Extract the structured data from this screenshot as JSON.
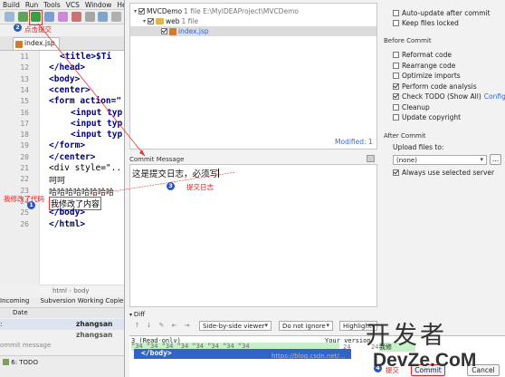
{
  "ide": {
    "menu": [
      "Build",
      "Run",
      "Tools",
      "VCS",
      "Window",
      "He"
    ],
    "file_tab": "index.jsp",
    "line_numbers": [
      "11",
      "12",
      "13",
      "14",
      "15",
      "16",
      "17",
      "18",
      "19",
      "20",
      "21",
      "22",
      "23",
      "24",
      "25",
      "26"
    ],
    "code_lines": [
      "<title>$Ti",
      "</head>",
      "<body>",
      "<center>",
      "<form action=\"",
      "<input typ",
      "<input typ",
      "<input typ",
      "</form>",
      "</center>",
      "<div style=\"..",
      "呵呵",
      "哈哈哈哈哈哈哈哈",
      "我修改了内容",
      "</body>",
      "</html>"
    ],
    "breadcrumb": [
      "html",
      "body"
    ],
    "bottom_tabs": [
      "Incoming",
      "Subversion Working Copies"
    ],
    "history_header": "Date",
    "history_rows": [
      {
        "author": "zhangsan"
      },
      {
        "author": "zhangsan"
      }
    ],
    "status_left": "ommit message",
    "status_todo": "6: TODO"
  },
  "annotations": {
    "step2": "2",
    "click_commit": "点击提交",
    "modified_code": "我修改了代码",
    "step1": "1",
    "step3": "3",
    "commit_log": "提交日志",
    "step4": "4",
    "submit": "提交"
  },
  "dialog": {
    "tree": {
      "root": "MVCDemo",
      "root_meta": "1 file  E:\\MyIDEAProject\\MVCDemo",
      "folder": "web",
      "folder_meta": "1 file",
      "file": "index.jsp"
    },
    "modified": "Modified: 1",
    "commit_message_label": "Commit Message",
    "commit_message": "这是提交日志，必须写",
    "options_top": [
      {
        "label": "Auto-update after commit",
        "checked": false
      },
      {
        "label": "Keep files locked",
        "checked": false
      }
    ],
    "before_commit_title": "Before Commit",
    "before_commit": [
      {
        "label": "Reformat code",
        "checked": false
      },
      {
        "label": "Rearrange code",
        "checked": false
      },
      {
        "label": "Optimize imports",
        "checked": false
      },
      {
        "label": "Perform code analysis",
        "checked": true
      },
      {
        "label": "Check TODO (Show All)",
        "checked": true,
        "link": "Configure"
      },
      {
        "label": "Cleanup",
        "checked": false
      },
      {
        "label": "Update copyright",
        "checked": false
      }
    ],
    "after_commit_title": "After Commit",
    "upload_files_to": "Upload files to:",
    "upload_value": "(none)",
    "upload_more": "...",
    "always_use_selected_server": "Always use selected server",
    "diff": {
      "label": "Diff",
      "viewer": "Side-by-side viewer",
      "whitespace": "Do not ignore",
      "highlight": "Highlight",
      "left_title": "3 (Read-only)",
      "right_title": "Your version",
      "left_line": "ʺ34 ʺ34 ʺ34 ʺ34 ʺ34 ʺ34 ʺ34 ʺ34",
      "selected_line": "</body>",
      "line_a": "24",
      "line_b": "24",
      "right_text": "我修"
    },
    "buttons": {
      "commit": "Commit",
      "cancel": "Cancel"
    }
  },
  "watermark": {
    "line1": "开发者",
    "line2": "DevZe.CoM",
    "url": "https://blog.csdn.net/..."
  },
  "colors": {
    "annotation_red": "#e02020",
    "link_blue": "#2a69d0",
    "selection": "#2f65ca",
    "step_badge": "#2b55c0"
  }
}
